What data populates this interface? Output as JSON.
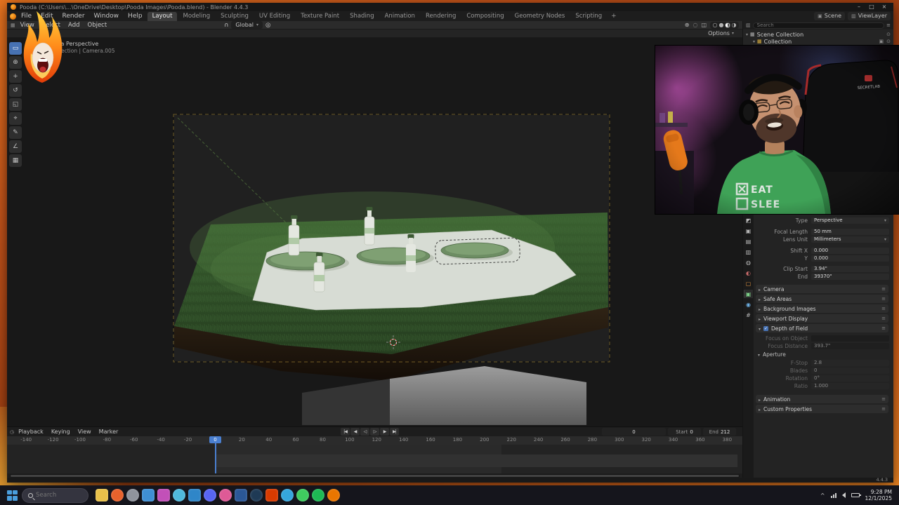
{
  "titlebar": {
    "title": "Pooda (C:\\Users\\...\\OneDrive\\Desktop\\Pooda Images\\Pooda.blend) - Blender 4.4.3",
    "controls": {
      "minimize": "–",
      "maximize": "□",
      "close": "×"
    }
  },
  "icons": {
    "caret": "▾",
    "caret_r": "▸",
    "eye": "⊙",
    "camera_small": "▣",
    "menu": "≡",
    "clock": "◷",
    "grid": "▦",
    "layers": "▥",
    "chevron_up": "^",
    "check": "✓",
    "magnet": "∩",
    "proportional": "◎",
    "gizmo": "⊕",
    "overlays": "◌",
    "xray": "◫"
  },
  "menubar": {
    "menus": [
      "File",
      "Edit",
      "Render",
      "Window",
      "Help"
    ],
    "workspaces": [
      "Layout",
      "Modeling",
      "Sculpting",
      "UV Editing",
      "Texture Paint",
      "Shading",
      "Animation",
      "Rendering",
      "Compositing",
      "Geometry Nodes",
      "Scripting"
    ],
    "active_workspace": "Layout",
    "add_workspace": "+",
    "scene_name": "Scene",
    "view_layer_name": "ViewLayer"
  },
  "viewport": {
    "menus": [
      "View",
      "Select",
      "Add",
      "Object"
    ],
    "orientation": "Global",
    "options_label": "Options",
    "overlay_line1": "Camera Perspective",
    "overlay_line2": "(1) Collection | Camera.005",
    "shading_modes": [
      {
        "name": "wireframe",
        "glyph": "○"
      },
      {
        "name": "solid",
        "glyph": "●"
      },
      {
        "name": "material-preview",
        "glyph": "◐",
        "active": true
      },
      {
        "name": "rendered",
        "glyph": "◑"
      }
    ],
    "tools": [
      {
        "name": "select-box",
        "glyph": "▭",
        "active": true
      },
      {
        "name": "cursor",
        "glyph": "⊕"
      },
      {
        "name": "move",
        "glyph": "+"
      },
      {
        "name": "rotate",
        "glyph": "↺"
      },
      {
        "name": "scale",
        "glyph": "◱"
      },
      {
        "name": "transform",
        "glyph": "⌖"
      },
      {
        "name": "annotate",
        "glyph": "✎"
      },
      {
        "name": "measure",
        "glyph": "∠"
      },
      {
        "name": "add-cube",
        "glyph": "▦"
      }
    ]
  },
  "outliner": {
    "search_placeholder": "Search",
    "row1": "Scene Collection",
    "row2": "Collection"
  },
  "properties": {
    "tabs": [
      {
        "name": "tool",
        "glyph": "◩",
        "fg": "#b8b8b8"
      },
      {
        "name": "render",
        "glyph": "▣",
        "fg": "#b8b8b8"
      },
      {
        "name": "output",
        "glyph": "▤",
        "fg": "#b8b8b8"
      },
      {
        "name": "view-layer",
        "glyph": "▥",
        "fg": "#b8b8b8"
      },
      {
        "name": "scene",
        "glyph": "◍",
        "fg": "#b8b8b8"
      },
      {
        "name": "world",
        "glyph": "◐",
        "fg": "#c86a6a"
      },
      {
        "name": "object",
        "glyph": "▢",
        "fg": "#e0923f"
      },
      {
        "name": "object-data-camera",
        "glyph": "▣",
        "fg": "#7fd38a",
        "active": true
      },
      {
        "name": "physics",
        "glyph": "◉",
        "fg": "#6fb3e8"
      },
      {
        "name": "constraints",
        "glyph": "#",
        "fg": "#b8b8b8"
      }
    ],
    "type_label": "Type",
    "type_value": "Perspective",
    "focal_label": "Focal Length",
    "focal_value": "50 mm",
    "lens_unit_label": "Lens Unit",
    "lens_unit_value": "Millimeters",
    "shift_x_label": "Shift X",
    "shift_x_value": "0.000",
    "shift_y_label": "Y",
    "shift_y_value": "0.000",
    "clip_start_label": "Clip Start",
    "clip_start_value": "3.94\"",
    "clip_end_label": "End",
    "clip_end_value": "39370\"",
    "sections_a": [
      {
        "label": "Camera"
      },
      {
        "label": "Safe Areas"
      },
      {
        "label": "Background Images"
      },
      {
        "label": "Viewport Display"
      }
    ],
    "dof_title": "Depth of Field",
    "focus_object_label": "Focus on Object",
    "focus_distance_label": "Focus Distance",
    "focus_distance_value": "393.7\"",
    "aperture_title": "Aperture",
    "fstop_label": "F-Stop",
    "fstop_value": "2.8",
    "blades_label": "Blades",
    "blades_value": "0",
    "rotation_label": "Rotation",
    "rotation_value": "0°",
    "ratio_label": "Ratio",
    "ratio_value": "1.000",
    "sections_b": [
      {
        "label": "Animation"
      },
      {
        "label": "Custom Properties"
      }
    ]
  },
  "timeline": {
    "menus": [
      "Playback",
      "Keying",
      "View",
      "Marker"
    ],
    "transport": [
      {
        "name": "jump-start",
        "glyph": "|◀"
      },
      {
        "name": "prev-keyframe",
        "glyph": "◀"
      },
      {
        "name": "play-reverse",
        "glyph": "◁"
      },
      {
        "name": "play",
        "glyph": "▷"
      },
      {
        "name": "next-keyframe",
        "glyph": "▶"
      },
      {
        "name": "jump-end",
        "glyph": "▶|"
      }
    ],
    "current_frame": "0",
    "playhead_label": "0",
    "start_label": "Start",
    "start_value": "0",
    "end_label": "End",
    "end_value": "212",
    "ruler": [
      "-140",
      "-120",
      "-100",
      "-80",
      "-60",
      "-40",
      "-20",
      "0",
      "20",
      "40",
      "60",
      "80",
      "100",
      "120",
      "140",
      "160",
      "180",
      "200",
      "220",
      "240",
      "260",
      "280",
      "300",
      "320",
      "340",
      "360",
      "380"
    ]
  },
  "statusbar": {
    "version": "4.4.3"
  },
  "webcam": {
    "shirt_line1": "EAT",
    "shirt_line2": "SLEE",
    "chair_brand": "SECRETLAB"
  },
  "taskbar": {
    "search_placeholder": "Search",
    "time": "9:28 PM",
    "date": "12/1/2025",
    "apps": [
      {
        "name": "file-explorer",
        "bg": "#e8c04a"
      },
      {
        "name": "firefox",
        "bg": "#e8622c",
        "round": true
      },
      {
        "name": "settings",
        "bg": "#8f939c",
        "round": true
      },
      {
        "name": "mail",
        "bg": "#3f8fd4"
      },
      {
        "name": "photos",
        "bg": "#c250b8"
      },
      {
        "name": "paint",
        "bg": "#4fb8dc",
        "round": true
      },
      {
        "name": "vscode",
        "bg": "#2f86c8"
      },
      {
        "name": "discord",
        "bg": "#5865f2",
        "round": true
      },
      {
        "name": "clip-studio",
        "bg": "#de5a96",
        "round": true
      },
      {
        "name": "word",
        "bg": "#2b5797"
      },
      {
        "name": "steam",
        "bg": "#1f3a55",
        "round": true
      },
      {
        "name": "office",
        "bg": "#d83b01"
      },
      {
        "name": "telegram",
        "bg": "#35a6dc",
        "round": true
      },
      {
        "name": "whatsapp",
        "bg": "#3fcc5f",
        "round": true
      },
      {
        "name": "spotify",
        "bg": "#1db954",
        "round": true
      },
      {
        "name": "blender",
        "bg": "#ea7600",
        "round": true
      }
    ]
  }
}
